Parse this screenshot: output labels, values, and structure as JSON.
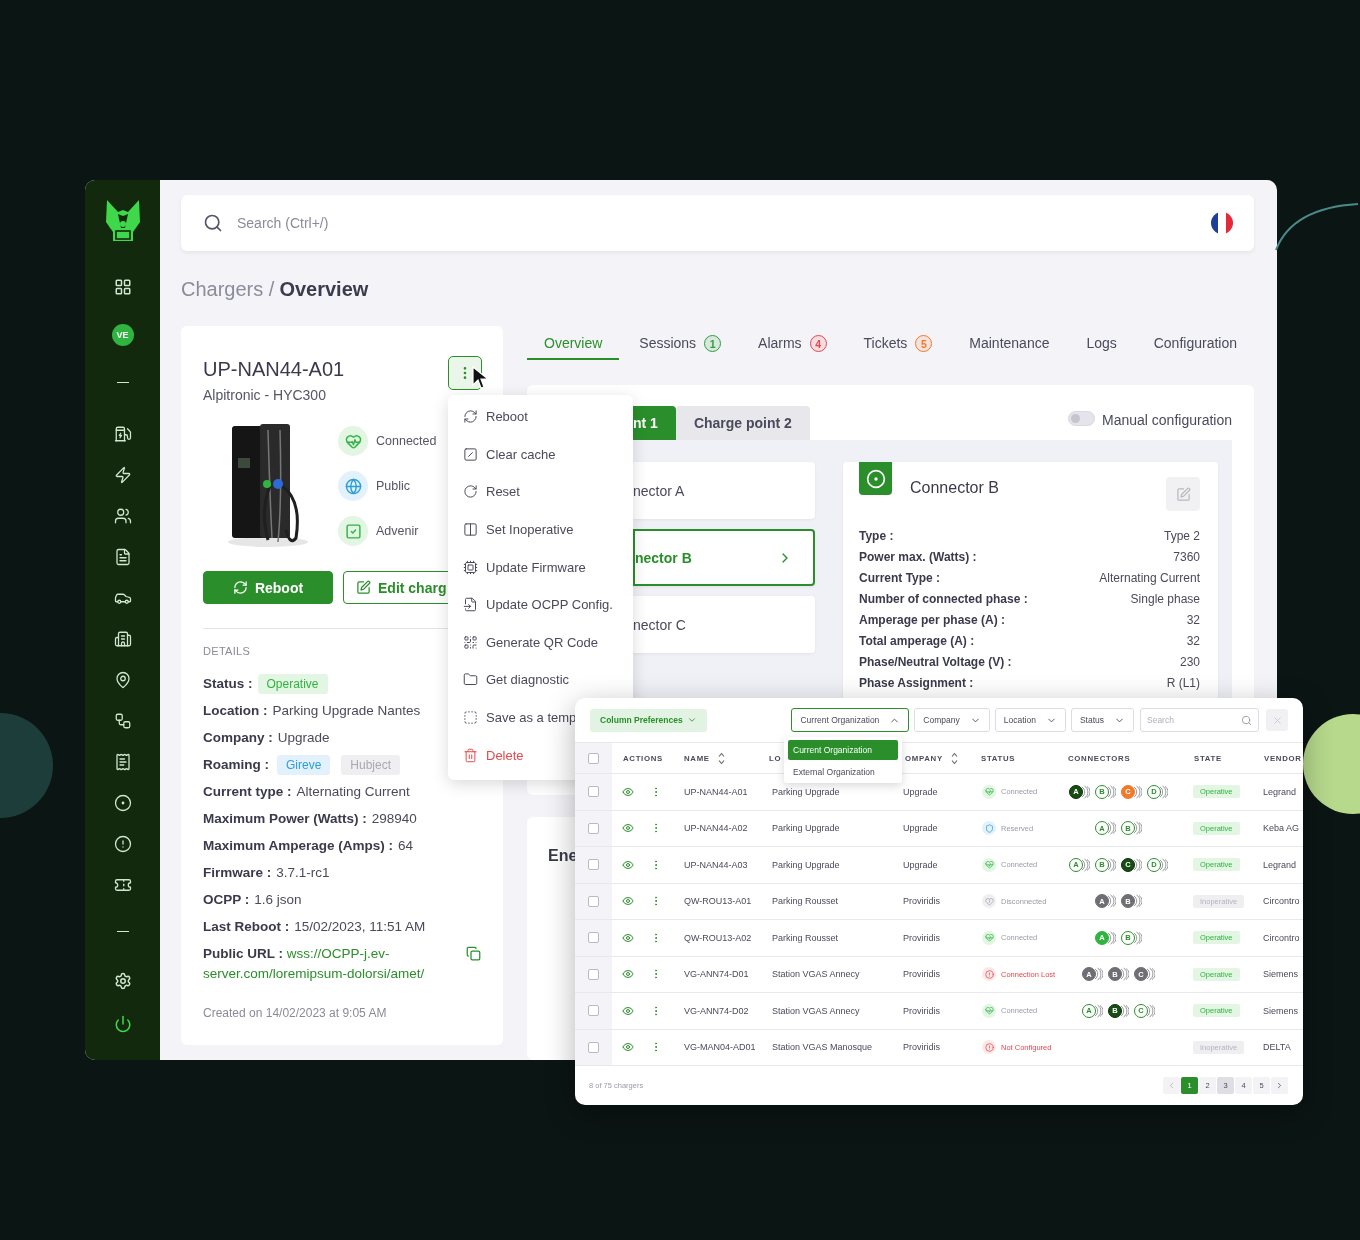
{
  "sidebar": {
    "avatar": "VE"
  },
  "search": {
    "placeholder": "Search (Ctrl+/)"
  },
  "breadcrumb": {
    "parent": "Chargers /",
    "current": "Overview"
  },
  "charger": {
    "name": "UP-NAN44-A01",
    "model": "Alpitronic - HYC300",
    "attributes": [
      {
        "label": "Connected",
        "kind": "connected"
      },
      {
        "label": "Public",
        "kind": "public"
      },
      {
        "label": "Advenir",
        "kind": "advenir"
      }
    ],
    "buttons": [
      {
        "label": "Reboot",
        "kind": "primary"
      },
      {
        "label": "Edit charg",
        "kind": "outline"
      }
    ],
    "details_heading": "DETAILS",
    "details": [
      {
        "label": "Status :",
        "kind": "badge",
        "value": "Operative"
      },
      {
        "label": "Location :",
        "kind": "text",
        "value": "Parking Upgrade Nantes"
      },
      {
        "label": "Company :",
        "kind": "text",
        "value": "Upgrade"
      },
      {
        "label": "Roaming :",
        "kind": "tags",
        "tags": [
          {
            "label": "Gireve",
            "active": true
          },
          {
            "label": "Hubject",
            "active": false
          }
        ]
      },
      {
        "label": "Current type :",
        "kind": "text",
        "value": "Alternating Current"
      },
      {
        "label": "Maximum Power (Watts) :",
        "kind": "text",
        "value": "298940"
      },
      {
        "label": "Maximum Amperage (Amps) :",
        "kind": "text",
        "value": "64"
      },
      {
        "label": "Firmware :",
        "kind": "text",
        "value": "3.7.1-rc1"
      },
      {
        "label": "OCPP :",
        "kind": "text",
        "value": "1.6 json"
      },
      {
        "label": "Last Reboot :",
        "kind": "text",
        "value": "15/02/2023, 11:51 AM"
      },
      {
        "label": "Public URL :",
        "kind": "link",
        "value": "wss://OCPP-j.ev-server.com/loremipsum-dolorsi/amet/"
      }
    ],
    "created": "Created on 14/02/2023 at 9:05 AM"
  },
  "menu": {
    "items": [
      {
        "label": "Reboot",
        "kind": "normal"
      },
      {
        "label": "Clear cache",
        "kind": "normal"
      },
      {
        "label": "Reset",
        "kind": "normal"
      },
      {
        "label": "Set Inoperative",
        "kind": "normal"
      },
      {
        "label": "Update Firmware",
        "kind": "normal"
      },
      {
        "label": "Update OCPP Config.",
        "kind": "normal"
      },
      {
        "label": "Generate QR Code",
        "kind": "normal"
      },
      {
        "label": "Get diagnostic",
        "kind": "normal"
      },
      {
        "label": "Save as a temp",
        "kind": "normal"
      },
      {
        "label": "Delete",
        "kind": "danger"
      }
    ]
  },
  "tabs": [
    {
      "label": "Overview",
      "selected": true
    },
    {
      "label": "Sessions",
      "selected": false,
      "count": "1",
      "color": "#2e9e3e"
    },
    {
      "label": "Alarms",
      "selected": false,
      "count": "4",
      "color": "#e5484d"
    },
    {
      "label": "Tickets",
      "selected": false,
      "count": "5",
      "color": "#f07a2a"
    },
    {
      "label": "Maintenance",
      "selected": false
    },
    {
      "label": "Logs",
      "selected": false
    },
    {
      "label": "Configuration",
      "selected": false
    }
  ],
  "charge_points": {
    "tabs": [
      {
        "label": "nt 1",
        "selected": true
      },
      {
        "label": "Charge point 2",
        "selected": false
      }
    ],
    "manual_configuration": {
      "label": "Manual configuration",
      "on": false
    }
  },
  "connectors": [
    {
      "label": "nector A",
      "selected": false
    },
    {
      "label": "nector B",
      "selected": true
    },
    {
      "label": "nector C",
      "selected": false
    }
  ],
  "connector_detail": {
    "title": "Connector B",
    "specs": [
      {
        "label": "Type :",
        "value": "Type 2"
      },
      {
        "label": "Power max. (Watts) :",
        "value": "7360"
      },
      {
        "label": "Current Type :",
        "value": "Alternating Current"
      },
      {
        "label": "Number of connected phase :",
        "value": "Single phase"
      },
      {
        "label": "Amperage per phase (A) :",
        "value": "32"
      },
      {
        "label": "Total amperage (A) :",
        "value": "32"
      },
      {
        "label": "Phase/Neutral Voltage (V) :",
        "value": "230"
      },
      {
        "label": "Phase Assignment :",
        "value": "R (L1)"
      }
    ]
  },
  "energy_card": {
    "title": "Ene"
  },
  "table": {
    "column_preferences": "Column Preferences",
    "filters": [
      {
        "label": "Current Organization",
        "open": true
      },
      {
        "label": "Company",
        "open": false
      },
      {
        "label": "Location",
        "open": false
      },
      {
        "label": "Status",
        "open": false
      }
    ],
    "search_placeholder": "Search",
    "dropdown": [
      {
        "label": "Current Organization",
        "selected": true
      },
      {
        "label": "External Organization",
        "selected": false
      }
    ],
    "all_checked": false,
    "columns": [
      {
        "label": "ACTIONS",
        "sortable": false
      },
      {
        "label": "NAME",
        "sortable": true
      },
      {
        "label": "LO",
        "sortable": false
      },
      {
        "label": "OMPANY",
        "sortable": true
      },
      {
        "label": "STATUS",
        "sortable": false
      },
      {
        "label": "CONNECTORS",
        "sortable": false
      },
      {
        "label": "STATE",
        "sortable": false
      },
      {
        "label": "VENDOR",
        "sortable": false
      }
    ],
    "rows": [
      {
        "checked": false,
        "name": "UP-NAN44-A01",
        "location": "Parking Upgrade",
        "company": "Upgrade",
        "status": {
          "kind": "connected",
          "label": "Connected"
        },
        "connectors": [
          {
            "label": "A",
            "kind": "charging"
          },
          {
            "label": "B",
            "kind": "available"
          },
          {
            "label": "C",
            "kind": "faulted"
          },
          {
            "label": "D",
            "kind": "available"
          }
        ],
        "state": {
          "kind": "operative",
          "label": "Operative"
        },
        "vendor": "Legrand"
      },
      {
        "checked": false,
        "name": "UP-NAN44-A02",
        "location": "Parking Upgrade",
        "company": "Upgrade",
        "status": {
          "kind": "reserved",
          "label": "Reserved"
        },
        "connectors": [
          {
            "label": "A",
            "kind": "available"
          },
          {
            "label": "B",
            "kind": "available"
          }
        ],
        "state": {
          "kind": "operative",
          "label": "Operative"
        },
        "vendor": "Keba AG"
      },
      {
        "checked": false,
        "name": "UP-NAN44-A03",
        "location": "Parking Upgrade",
        "company": "Upgrade",
        "status": {
          "kind": "connected",
          "label": "Connected"
        },
        "connectors": [
          {
            "label": "A",
            "kind": "available"
          },
          {
            "label": "B",
            "kind": "available"
          },
          {
            "label": "C",
            "kind": "charging"
          },
          {
            "label": "D",
            "kind": "available"
          }
        ],
        "state": {
          "kind": "operative",
          "label": "Operative"
        },
        "vendor": "Legrand"
      },
      {
        "checked": false,
        "name": "QW-ROU13-A01",
        "location": "Parking Rousset",
        "company": "Proviridis",
        "status": {
          "kind": "disconnected",
          "label": "Disconnected"
        },
        "connectors": [
          {
            "label": "A",
            "kind": "unavailable"
          },
          {
            "label": "B",
            "kind": "unavailable"
          }
        ],
        "state": {
          "kind": "inoperative",
          "label": "Inoperative"
        },
        "vendor": "Circontro"
      },
      {
        "checked": false,
        "name": "QW-ROU13-A02",
        "location": "Parking Rousset",
        "company": "Proviridis",
        "status": {
          "kind": "connected",
          "label": "Connected"
        },
        "connectors": [
          {
            "label": "A",
            "kind": "preparing"
          },
          {
            "label": "B",
            "kind": "available"
          }
        ],
        "state": {
          "kind": "operative",
          "label": "Operative"
        },
        "vendor": "Circontro"
      },
      {
        "checked": false,
        "name": "VG-ANN74-D01",
        "location": "Station VGAS Annecy",
        "company": "Proviridis",
        "status": {
          "kind": "lost",
          "label": "Connection Lost"
        },
        "connectors": [
          {
            "label": "A",
            "kind": "unavailable"
          },
          {
            "label": "B",
            "kind": "unavailable"
          },
          {
            "label": "C",
            "kind": "unavailable"
          }
        ],
        "state": {
          "kind": "operative",
          "label": "Operative"
        },
        "vendor": "Siemens"
      },
      {
        "checked": false,
        "name": "VG-ANN74-D02",
        "location": "Station VGAS Annecy",
        "company": "Proviridis",
        "status": {
          "kind": "connected",
          "label": "Connected"
        },
        "connectors": [
          {
            "label": "A",
            "kind": "available"
          },
          {
            "label": "B",
            "kind": "charging"
          },
          {
            "label": "C",
            "kind": "available"
          }
        ],
        "state": {
          "kind": "operative",
          "label": "Operative"
        },
        "vendor": "Siemens"
      },
      {
        "checked": false,
        "name": "VG-MAN04-AD01",
        "location": "Station VGAS Manosque",
        "company": "Proviridis",
        "status": {
          "kind": "lost",
          "label": "Not Configured"
        },
        "state": {
          "kind": "inoperative",
          "label": "Inoperative"
        },
        "vendor": "DELTA"
      }
    ],
    "footer": "8 of 75 chargers",
    "pages": [
      {
        "label": "1",
        "selected": true,
        "hovered": false
      },
      {
        "label": "2",
        "selected": false,
        "hovered": false
      },
      {
        "label": "3",
        "selected": false,
        "hovered": true
      },
      {
        "label": "4",
        "selected": false,
        "hovered": false
      },
      {
        "label": "5",
        "selected": false,
        "hovered": false
      }
    ]
  }
}
